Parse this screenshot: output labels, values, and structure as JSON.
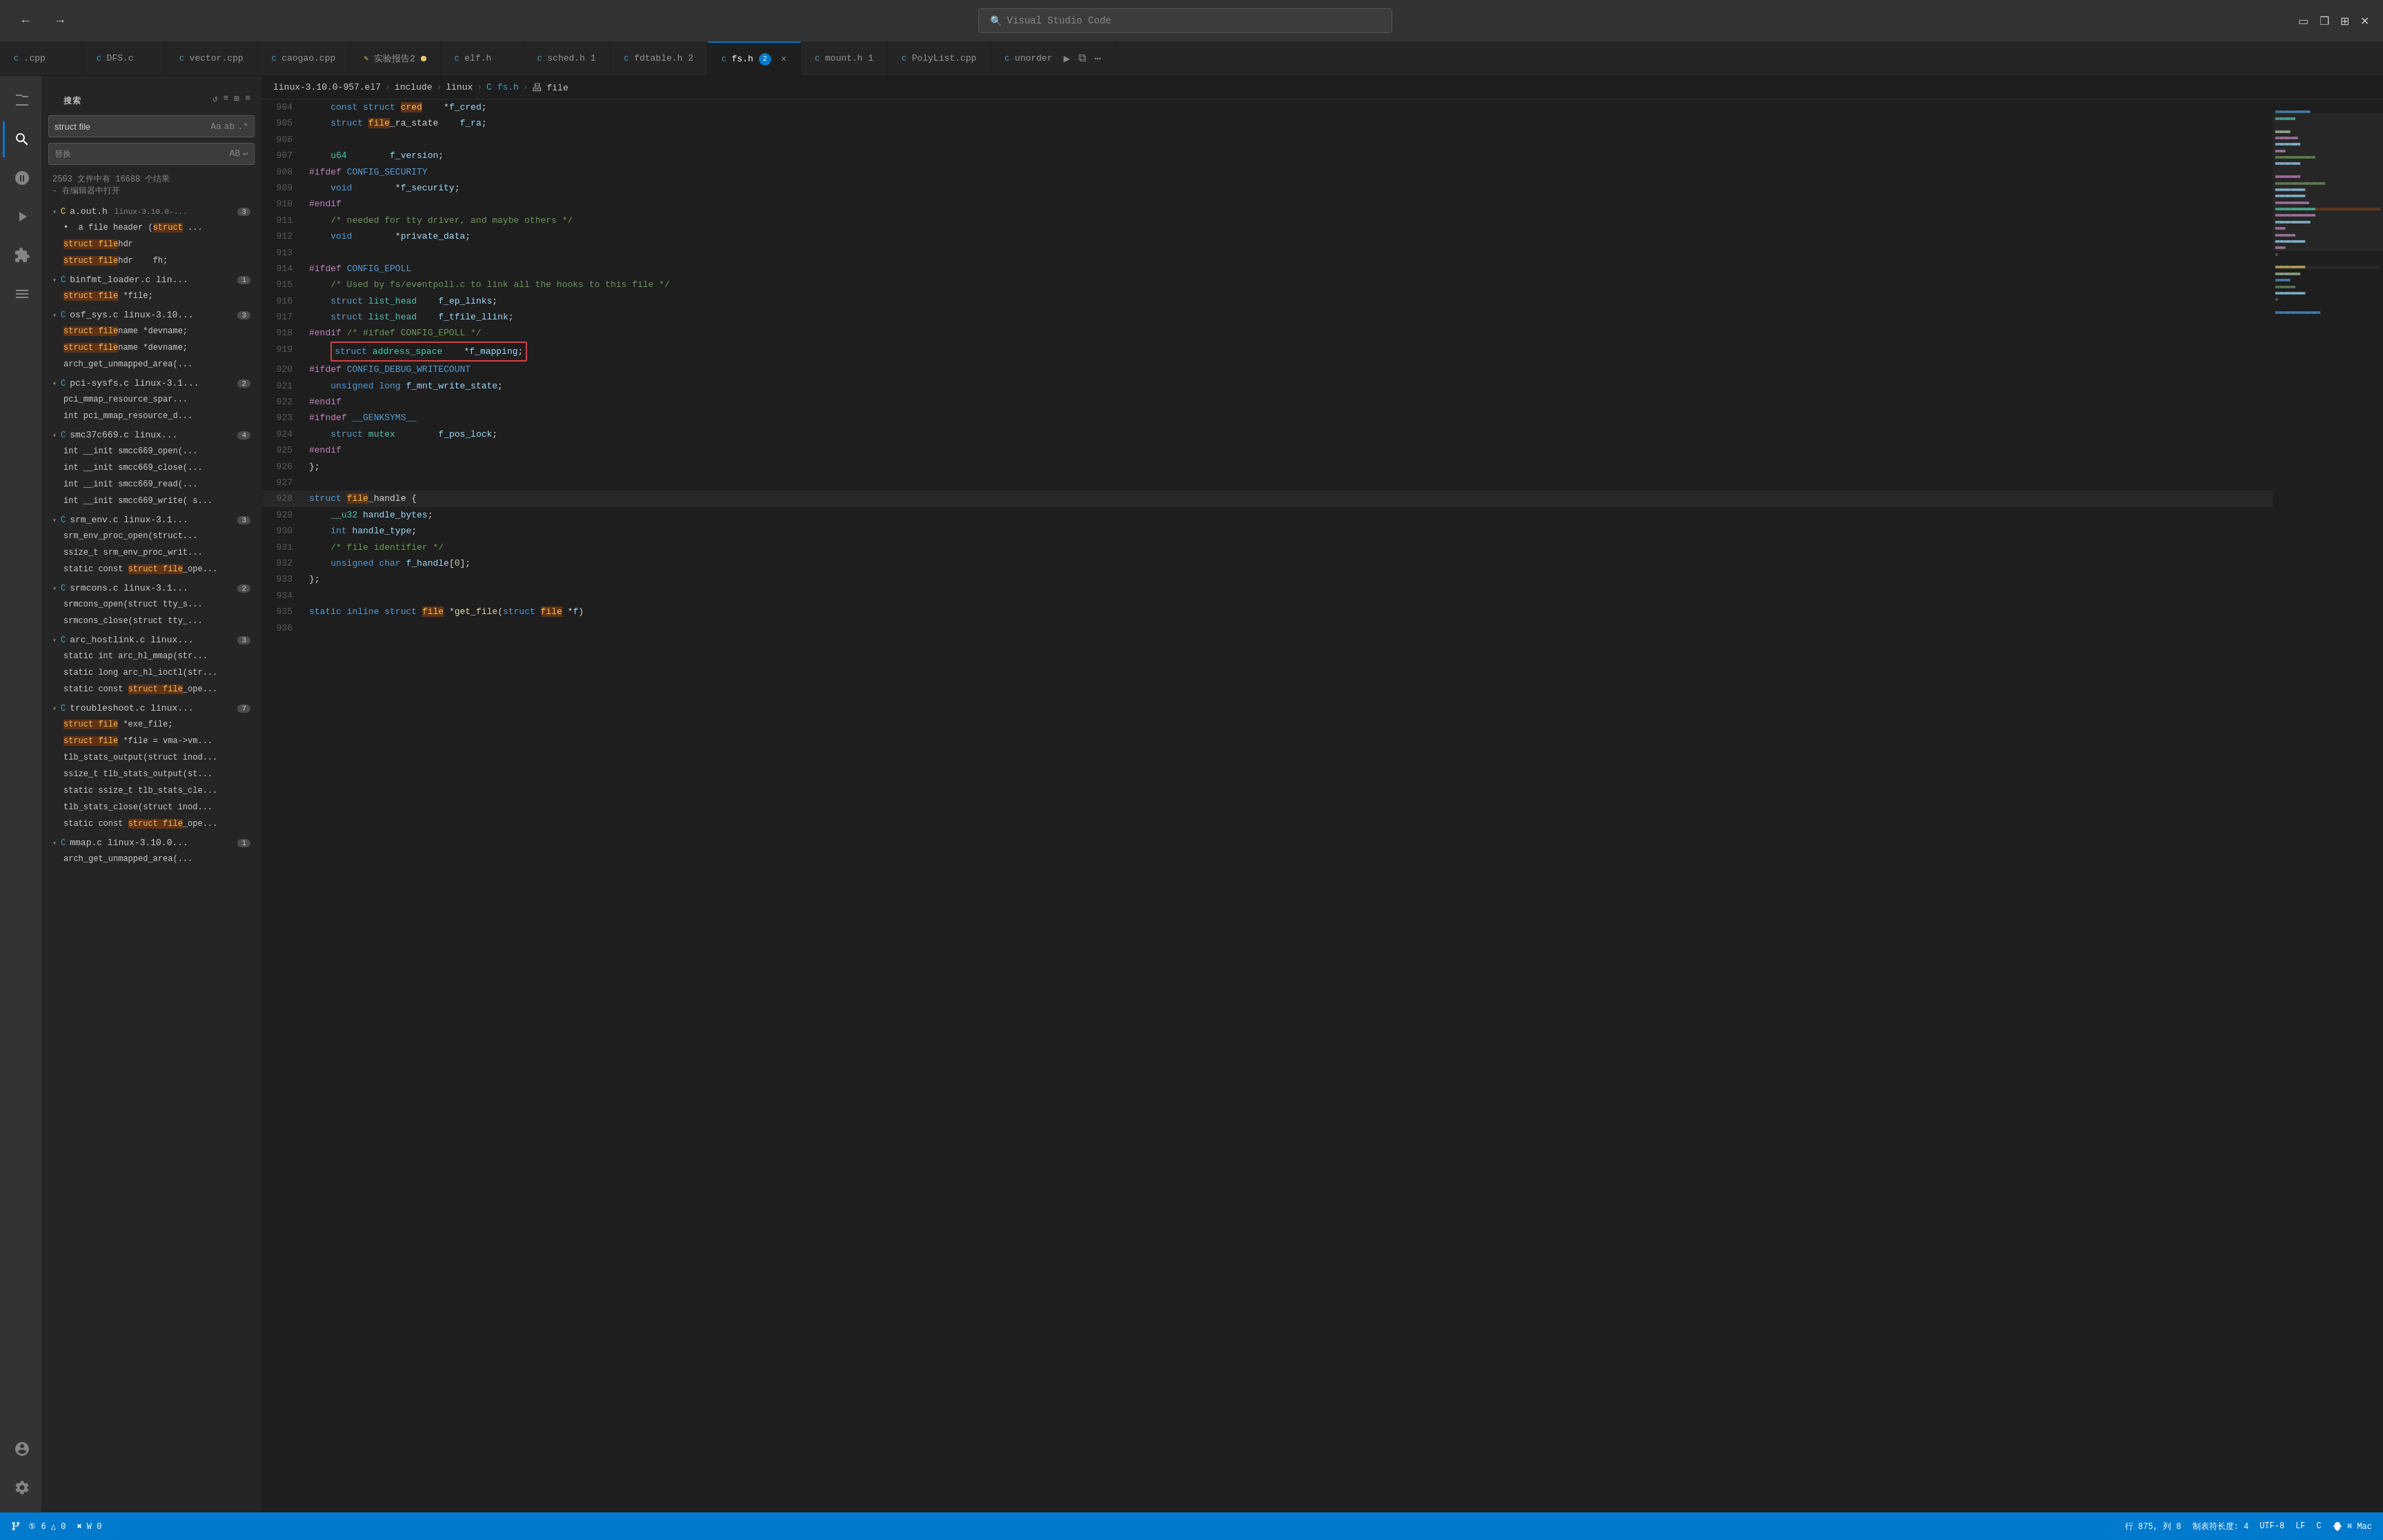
{
  "titlebar": {
    "back_label": "←",
    "forward_label": "→",
    "search_placeholder": "Visual Studio Code",
    "search_icon": "🔍",
    "win_controls": [
      "▭",
      "❐",
      "✕"
    ]
  },
  "tabs": [
    {
      "id": "cpp1",
      "icon": "C",
      "label": ".cpp",
      "active": false,
      "modified": false,
      "badge": null
    },
    {
      "id": "dfs",
      "icon": "C",
      "label": "DFS.c",
      "active": false,
      "modified": false,
      "badge": null
    },
    {
      "id": "vector",
      "icon": "C",
      "label": "vector.cpp",
      "active": false,
      "modified": false,
      "badge": null
    },
    {
      "id": "caogao",
      "icon": "C",
      "label": "caogao.cpp",
      "active": false,
      "modified": false,
      "badge": null
    },
    {
      "id": "shiyan",
      "icon": "✎",
      "label": "实验报告2",
      "active": false,
      "modified": true,
      "badge": null
    },
    {
      "id": "elf",
      "icon": "C",
      "label": "elf.h",
      "active": false,
      "modified": false,
      "badge": null
    },
    {
      "id": "sched",
      "icon": "C",
      "label": "sched.h 1",
      "active": false,
      "modified": false,
      "badge": null
    },
    {
      "id": "fdtable",
      "icon": "C",
      "label": "fdtable.h 2",
      "active": false,
      "modified": false,
      "badge": null
    },
    {
      "id": "fsh",
      "icon": "C",
      "label": "fs.h",
      "active": true,
      "modified": false,
      "badge": "2"
    },
    {
      "id": "mounth",
      "icon": "C",
      "label": "mount.h 1",
      "active": false,
      "modified": false,
      "badge": null
    },
    {
      "id": "polylist",
      "icon": "C",
      "label": "PolyList.cpp",
      "active": false,
      "modified": false,
      "badge": null
    },
    {
      "id": "unorder",
      "icon": "C",
      "label": "unorder",
      "active": false,
      "modified": false,
      "badge": null
    }
  ],
  "activity_bar": {
    "items": [
      {
        "id": "search",
        "icon": "⊞",
        "active": false
      },
      {
        "id": "file-explorer",
        "icon": "🔍",
        "active": true
      },
      {
        "id": "source-control",
        "icon": "⎇",
        "active": false
      },
      {
        "id": "run",
        "icon": "▶",
        "active": false
      },
      {
        "id": "extensions",
        "icon": "⊡",
        "active": false
      },
      {
        "id": "bookmarks",
        "icon": "☰",
        "active": false
      }
    ],
    "bottom_items": [
      {
        "id": "account",
        "icon": "👤",
        "active": false
      },
      {
        "id": "settings",
        "icon": "⚙",
        "active": false
      }
    ]
  },
  "sidebar": {
    "header": "搜索",
    "toolbar_icons": [
      "↺",
      "≡",
      "⊞",
      "≡"
    ],
    "search_value": "struct file",
    "search_options": [
      "Aa",
      "ab",
      ".*"
    ],
    "replace_label": "替换",
    "replace_options": [
      "AB",
      "↩"
    ],
    "result_count": "2503 文件中有 16688 个结果",
    "result_note": "- 在编辑器中打开",
    "files": [
      {
        "name": "a.out.h",
        "path": "linux-3.10.0-...",
        "badge": "3",
        "expanded": true,
        "items": [
          "• a file header (struct ...",
          "struct filehdr",
          "struct filehdr    fh;"
        ]
      },
      {
        "name": "binfmt_loader.c lin...",
        "path": "",
        "badge": "1",
        "expanded": true,
        "items": [
          "struct file *file;"
        ]
      },
      {
        "name": "osf_sys.c linux-3.10...",
        "path": "",
        "badge": "3",
        "expanded": true,
        "items": [
          "struct filename *devname;",
          "struct filename *devname;"
        ]
      },
      {
        "name": "pci-sysfs.c linux-3.1...",
        "path": "",
        "badge": "2",
        "expanded": true,
        "items": [
          "pci_mmap_resource_spar...",
          "int pci_mmap_resource_d..."
        ]
      },
      {
        "name": "smc37c669.c linux...",
        "path": "",
        "badge": "4",
        "expanded": true,
        "items": [
          "int __init smcc669_open(...",
          "int __init smcc669_close(...",
          "int __init smcc669_read(...",
          "int __init smcc669_write( s..."
        ]
      },
      {
        "name": "srm_env.c linux-3.1...",
        "path": "",
        "badge": "3",
        "expanded": true,
        "items": [
          "srm_env_proc_open(struct...",
          "ssize_t srm_env_proc_writ...",
          "static const struct file_ope..."
        ]
      },
      {
        "name": "srmcons.c linux-3.1...",
        "path": "",
        "badge": "2",
        "expanded": true,
        "items": [
          "srmcons_open(struct tty_s...",
          "srmcons_close(struct tty_..."
        ]
      },
      {
        "name": "arc_hostlink.c linux...",
        "path": "",
        "badge": "3",
        "expanded": true,
        "items": [
          "static int arc_hl_mmap(str...",
          "static long arc_hl_ioctl(str...",
          "static const struct file_ope..."
        ]
      },
      {
        "name": "troubleshoot.c linux...",
        "path": "",
        "badge": "7",
        "expanded": true,
        "items": [
          "struct file *exe_file;",
          "struct file *file = vma->vm...",
          "tlb_stats_output(struct inod...",
          "ssize_t tlb_stats_output(st...",
          "static ssize_t tlb_stats_cle...",
          "tlb_stats_close(struct inod...",
          "static const struct file_ope..."
        ]
      },
      {
        "name": "mmap.c linux-3.10.0...",
        "path": "",
        "badge": "1",
        "expanded": true,
        "items": [
          "arch_get_unmapped_area(..."
        ]
      }
    ]
  },
  "breadcrumb": {
    "parts": [
      "linux-3.10.0-957.el7",
      "include",
      "linux",
      "fs.h",
      "品 file"
    ]
  },
  "code": {
    "lines": [
      {
        "num": 904,
        "text": "    const struct cred    *f_cred;"
      },
      {
        "num": 905,
        "text": "    struct file_ra_state    f_ra;"
      },
      {
        "num": 906,
        "text": ""
      },
      {
        "num": 907,
        "text": "    u64        f_version;"
      },
      {
        "num": 908,
        "text": "#ifdef CONFIG_SECURITY"
      },
      {
        "num": 909,
        "text": "    void        *f_security;"
      },
      {
        "num": 910,
        "text": "#endif"
      },
      {
        "num": 911,
        "text": "    /* needed for tty driver, and maybe others */"
      },
      {
        "num": 912,
        "text": "    void        *private_data;"
      },
      {
        "num": 913,
        "text": ""
      },
      {
        "num": 914,
        "text": "#ifdef CONFIG_EPOLL"
      },
      {
        "num": 915,
        "text": "    /* Used by fs/eventpoll.c to link all the hooks to this file */"
      },
      {
        "num": 916,
        "text": "    struct list_head    f_ep_links;"
      },
      {
        "num": 917,
        "text": "    struct list_head    f_tfile_llink;"
      },
      {
        "num": 918,
        "text": "#endif /* #ifdef CONFIG_EPOLL */"
      },
      {
        "num": 919,
        "text": "    struct address_space    *f_mapping;",
        "boxed": true
      },
      {
        "num": 920,
        "text": "#ifdef CONFIG_DEBUG_WRITECOUNT"
      },
      {
        "num": 921,
        "text": "    unsigned long f_mnt_write_state;"
      },
      {
        "num": 922,
        "text": "#endif"
      },
      {
        "num": 923,
        "text": "#ifndef __GENKSYMS__"
      },
      {
        "num": 924,
        "text": "    struct mutex        f_pos_lock;"
      },
      {
        "num": 925,
        "text": "#endif"
      },
      {
        "num": 926,
        "text": "};"
      },
      {
        "num": 927,
        "text": ""
      },
      {
        "num": 928,
        "text": "struct file_handle {",
        "highlighted": true
      },
      {
        "num": 929,
        "text": "    __u32 handle_bytes;"
      },
      {
        "num": 930,
        "text": "    int handle_type;"
      },
      {
        "num": 931,
        "text": "    /* file identifier */"
      },
      {
        "num": 932,
        "text": "    unsigned char f_handle[0];"
      },
      {
        "num": 933,
        "text": "};"
      },
      {
        "num": 934,
        "text": ""
      },
      {
        "num": 935,
        "text": "static inline struct file *get_file(struct file *f)"
      },
      {
        "num": 936,
        "text": ""
      }
    ]
  },
  "statusbar": {
    "left": [
      {
        "icon": "⑤",
        "label": "6 △ 0"
      },
      {
        "icon": "✖",
        "label": "W 0"
      }
    ],
    "right": [
      {
        "label": "行 875, 列 8"
      },
      {
        "label": "制表符长度: 4"
      },
      {
        "label": "UTF-8"
      },
      {
        "label": "LF"
      },
      {
        "label": "C"
      },
      {
        "label": "⌘ Mac"
      }
    ]
  }
}
